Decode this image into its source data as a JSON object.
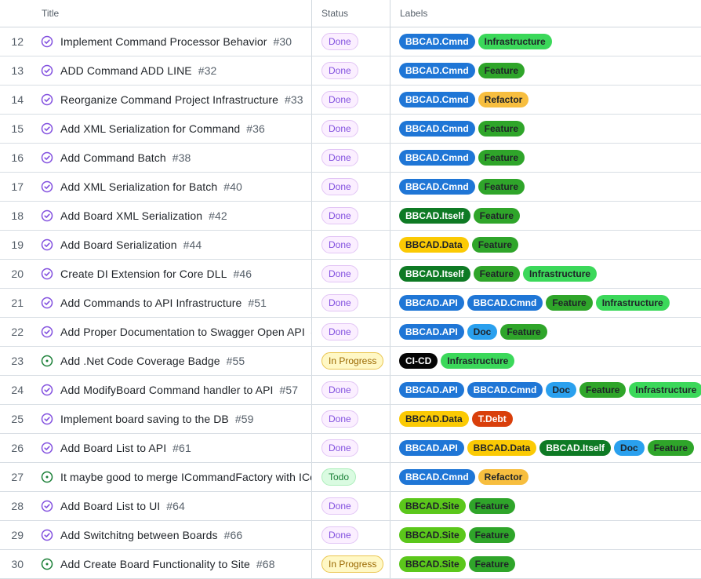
{
  "header": {
    "title": "Title",
    "status": "Status",
    "labels": "Labels"
  },
  "colors": {
    "BBCAD.Cmnd": {
      "bg": "#1f76d6",
      "fg": "#ffffff"
    },
    "BBCAD.API": {
      "bg": "#1f76d6",
      "fg": "#ffffff"
    },
    "BBCAD.Itself": {
      "bg": "#0e7a24",
      "fg": "#ffffff"
    },
    "BBCAD.Data": {
      "bg": "#fbca04",
      "fg": "#1f2328"
    },
    "BBCAD.Site": {
      "bg": "#5bc71b",
      "fg": "#1f2328"
    },
    "Infrastructure": {
      "bg": "#3bd85a",
      "fg": "#1f2328"
    },
    "Feature": {
      "bg": "#2fa52a",
      "fg": "#1f2328"
    },
    "Refactor": {
      "bg": "#f7be3f",
      "fg": "#1f2328"
    },
    "Doc": {
      "bg": "#2aa0ee",
      "fg": "#1f2328"
    },
    "CI-CD": {
      "bg": "#050505",
      "fg": "#ffffff"
    },
    "T.Debt": {
      "bg": "#d93f0b",
      "fg": "#ffffff"
    }
  },
  "rows": [
    {
      "n": "12",
      "title": "Implement Command Processor Behavior",
      "num": "#30",
      "icon": "closed",
      "status": "Done",
      "labels": [
        "BBCAD.Cmnd",
        "Infrastructure"
      ]
    },
    {
      "n": "13",
      "title": "ADD Command ADD LINE",
      "num": "#32",
      "icon": "closed",
      "status": "Done",
      "labels": [
        "BBCAD.Cmnd",
        "Feature"
      ]
    },
    {
      "n": "14",
      "title": "Reorganize Command Project Infrastructure",
      "num": "#33",
      "icon": "closed",
      "status": "Done",
      "labels": [
        "BBCAD.Cmnd",
        "Refactor"
      ]
    },
    {
      "n": "15",
      "title": "Add XML Serialization for Command",
      "num": "#36",
      "icon": "closed",
      "status": "Done",
      "labels": [
        "BBCAD.Cmnd",
        "Feature"
      ]
    },
    {
      "n": "16",
      "title": "Add Command Batch",
      "num": "#38",
      "icon": "closed",
      "status": "Done",
      "labels": [
        "BBCAD.Cmnd",
        "Feature"
      ]
    },
    {
      "n": "17",
      "title": "Add XML Serialization for Batch",
      "num": "#40",
      "icon": "closed",
      "status": "Done",
      "labels": [
        "BBCAD.Cmnd",
        "Feature"
      ]
    },
    {
      "n": "18",
      "title": "Add Board XML Serialization",
      "num": "#42",
      "icon": "closed",
      "status": "Done",
      "labels": [
        "BBCAD.Itself",
        "Feature"
      ]
    },
    {
      "n": "19",
      "title": "Add Board Serialization",
      "num": "#44",
      "icon": "closed",
      "status": "Done",
      "labels": [
        "BBCAD.Data",
        "Feature"
      ]
    },
    {
      "n": "20",
      "title": "Create DI Extension for Core DLL",
      "num": "#46",
      "icon": "closed",
      "status": "Done",
      "labels": [
        "BBCAD.Itself",
        "Feature",
        "Infrastructure"
      ]
    },
    {
      "n": "21",
      "title": "Add Commands to API Infrastructure",
      "num": "#51",
      "icon": "closed",
      "status": "Done",
      "labels": [
        "BBCAD.API",
        "BBCAD.Cmnd",
        "Feature",
        "Infrastructure"
      ]
    },
    {
      "n": "22",
      "title": "Add Proper Documentation to Swagger Open API",
      "num": "#",
      "icon": "closed",
      "status": "Done",
      "labels": [
        "BBCAD.API",
        "Doc",
        "Feature"
      ]
    },
    {
      "n": "23",
      "title": "Add .Net Code Coverage Badge",
      "num": "#55",
      "icon": "open",
      "status": "In Progress",
      "labels": [
        "CI-CD",
        "Infrastructure"
      ]
    },
    {
      "n": "24",
      "title": "Add ModifyBoard Command handler to API",
      "num": "#57",
      "icon": "closed",
      "status": "Done",
      "labels": [
        "BBCAD.API",
        "BBCAD.Cmnd",
        "Doc",
        "Feature",
        "Infrastructure"
      ]
    },
    {
      "n": "25",
      "title": "Implement board saving to the DB",
      "num": "#59",
      "icon": "closed",
      "status": "Done",
      "labels": [
        "BBCAD.Data",
        "T.Debt"
      ]
    },
    {
      "n": "26",
      "title": "Add Board List to API",
      "num": "#61",
      "icon": "closed",
      "status": "Done",
      "labels": [
        "BBCAD.API",
        "BBCAD.Data",
        "BBCAD.Itself",
        "Doc",
        "Feature"
      ]
    },
    {
      "n": "27",
      "title": "It maybe good to merge ICommandFactory with ICo",
      "num": "",
      "icon": "open",
      "status": "Todo",
      "labels": [
        "BBCAD.Cmnd",
        "Refactor"
      ]
    },
    {
      "n": "28",
      "title": "Add Board List to UI",
      "num": "#64",
      "icon": "closed",
      "status": "Done",
      "labels": [
        "BBCAD.Site",
        "Feature"
      ]
    },
    {
      "n": "29",
      "title": "Add Switchitng between Boards",
      "num": "#66",
      "icon": "closed",
      "status": "Done",
      "labels": [
        "BBCAD.Site",
        "Feature"
      ]
    },
    {
      "n": "30",
      "title": "Add Create Board Functionality to Site",
      "num": "#68",
      "icon": "open",
      "status": "In Progress",
      "labels": [
        "BBCAD.Site",
        "Feature"
      ]
    }
  ]
}
